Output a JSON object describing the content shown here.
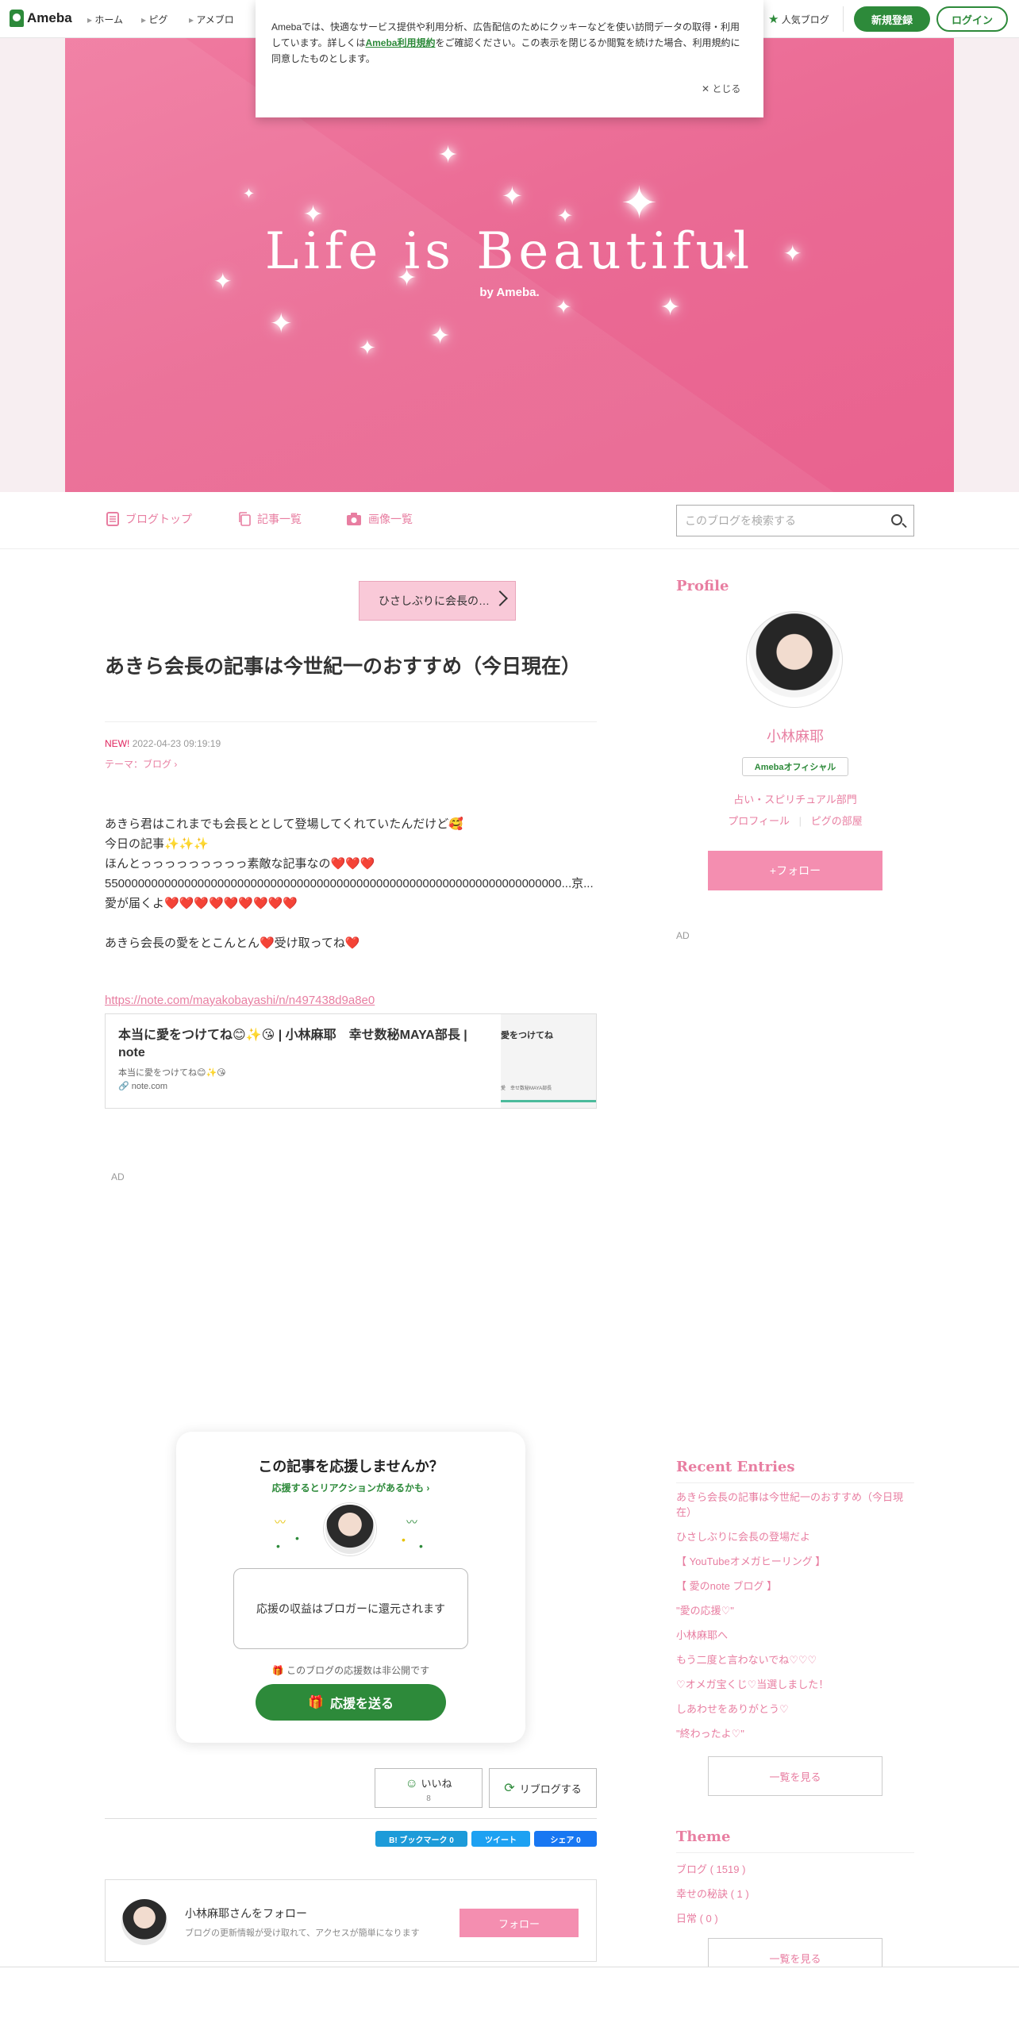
{
  "topbar": {
    "logo": "Ameba",
    "nav": [
      "ホーム",
      "ピグ",
      "アメブロ"
    ],
    "popular_blog": "人気ブログ",
    "signup": "新規登録",
    "login": "ログイン"
  },
  "cookie": {
    "text_before": "Amebaでは、快適なサービス提供や利用分析、広告配信のためにクッキーなどを使い訪問データの取得・利用しています。詳しくは",
    "link": "Ameba利用規約",
    "text_after": "をご確認ください。この表示を閉じるか閲覧を続けた場合、利用規約に同意したものとします。",
    "close": "とじる"
  },
  "hero": {
    "title": "Life is Beautiful",
    "by": "by Ameba.",
    "color": "#ec6e97"
  },
  "blognav": {
    "top": "ブログトップ",
    "entries": "記事一覧",
    "images": "画像一覧",
    "search_placeholder": "このブログを検索する"
  },
  "article": {
    "prev": "ひさしぶりに会長の…",
    "title": "あきら会長の記事は今世紀一のおすすめ（今日現在）",
    "new_label": "NEW!",
    "datetime": "2022-04-23 09:19:19",
    "theme": "テーマ：ブログ",
    "lines": [
      "あきら君はこれまでも会長ととして登場してくれていたんだけど🥰",
      "今日の記事✨✨✨",
      "ほんとっっっっっっっっっ素敵な記事なの❤️❤️❤️",
      "550000000000000000000000000000000000000000000000000000000000000000000...京...",
      "愛が届くよ❤️❤️❤️❤️❤️❤️❤️❤️❤️",
      "",
      "あきら会長の愛をとこんとん❤️受け取ってね❤️"
    ],
    "link": "https://note.com/mayakobayashi/n/n497438d9a8e0",
    "card": {
      "title": "本当に愛をつけてね😊✨😘 | 小林麻耶　幸せ数秘MAYA部長 | note",
      "desc": "本当に愛をつけてね😊✨😘",
      "site": "note.com",
      "thumb_title": "愛をつけてね",
      "thumb_sub": "愛　幸せ数秘MAYA部長"
    },
    "ad": "AD"
  },
  "support": {
    "title": "この記事を応援しませんか？",
    "sub": "応援するとリアクションがあるかも",
    "note": "応援の収益はブロガーに還元されます",
    "count": "このブログの応援数は非公開です",
    "button": "応援を送る"
  },
  "reactions": {
    "like": "いいね",
    "like_count": "8",
    "reblog": "リブログする"
  },
  "share": {
    "hatena": "B! ブックマーク 0",
    "tweet": "ツイート",
    "facebook": "シェア 0"
  },
  "follow": {
    "name": "小林麻耶さんをフォロー",
    "desc": "ブログの更新情報が受け取れて、アクセスが簡単になります",
    "button": "フォロー"
  },
  "sidebar": {
    "profile_heading": "Profile",
    "name": "小林麻耶",
    "official": "Amebaオフィシャル",
    "category": "占い・スピリチュアル部門",
    "profile_link": "プロフィール",
    "pig_link": "ピグの部屋",
    "follow": "+フォロー",
    "ad": "AD",
    "recent_heading": "Recent Entries",
    "recent": [
      "あきら会長の記事は今世紀一のおすすめ（今日現在）",
      "ひさしぶりに会長の登場だよ",
      "【 YouTubeオメガヒーリング 】",
      "【 愛のnote ブログ 】",
      "\"愛の応援♡\"",
      "小林麻耶へ",
      "もう二度と言わないでね♡♡♡",
      "♡オメガ宝くじ♡当選しました！",
      "しあわせをありがとう♡",
      "\"終わったよ♡\""
    ],
    "see_all": "一覧を見る",
    "theme_heading": "Theme",
    "themes": [
      "ブログ ( 1519 )",
      "幸せの秘訣 ( 1 )",
      "日常 ( 0 )"
    ]
  }
}
